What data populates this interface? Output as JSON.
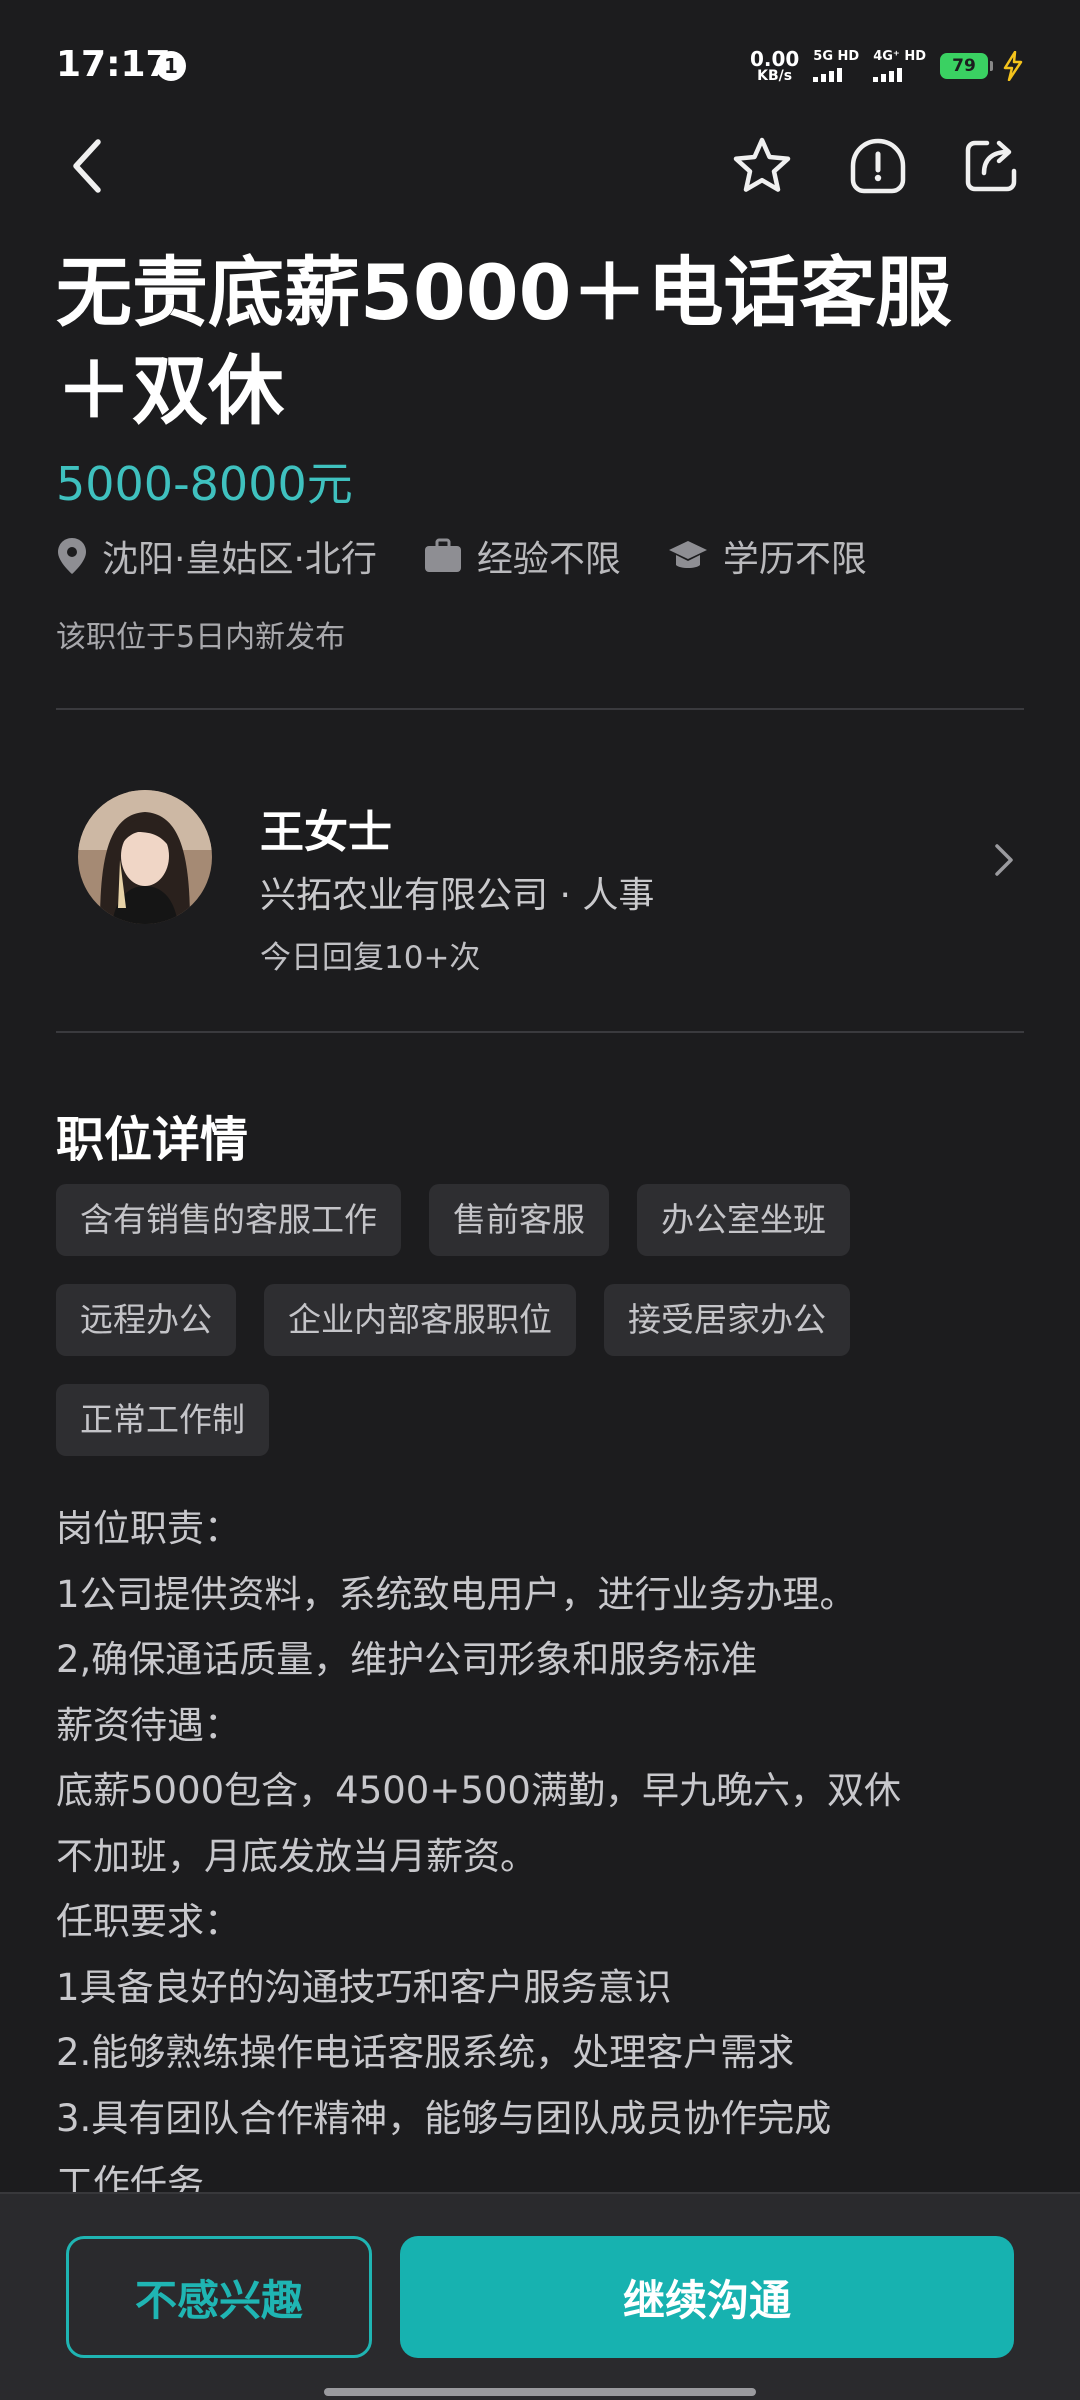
{
  "status_bar": {
    "time": "17:17",
    "alert_badge": "1",
    "net_speed_value": "0.00",
    "net_speed_unit": "KB/s",
    "sim1_label": "5G HD",
    "sim2_label": "4G⁺ HD",
    "battery": "79"
  },
  "icons": {
    "back": "chevron-left-icon",
    "favorite": "star-icon",
    "report": "alert-icon",
    "share": "share-icon",
    "location": "location-pin-icon",
    "experience": "briefcase-icon",
    "education": "graduation-cap-icon"
  },
  "job": {
    "title": "无责底薪5000＋电话客服＋双休",
    "salary": "5000-8000元",
    "location": "沈阳·皇姑区·北行",
    "experience": "经验不限",
    "education": "学历不限",
    "posted": "该职位于5日内新发布"
  },
  "recruiter": {
    "name": "王女士",
    "company": "兴拓农业有限公司 · 人事",
    "reply_stat": "今日回复10+次"
  },
  "details": {
    "section_title": "职位详情",
    "tags_row1": [
      "含有销售的客服工作",
      "售前客服",
      "办公室坐班"
    ],
    "tags_row2": [
      "远程办公",
      "企业内部客服职位",
      "接受居家办公"
    ],
    "tags_row3": [
      "正常工作制"
    ],
    "description_lines": [
      "岗位职责：",
      "1公司提供资料，系统致电用户，进行业务办理。",
      "2,确保通话质量，维护公司形象和服务标准",
      "薪资待遇：",
      "底薪5000包含，4500+500满勤，早九晚六，双休",
      "不加班，月底发放当月薪资。",
      "任职要求：",
      "1具备良好的沟通技巧和客户服务意识",
      "2.能够熟练操作电话客服系统，处理客户需求",
      "3.具有团队合作精神，能够与团队成员协作完成",
      "工作任务"
    ]
  },
  "actions": {
    "not_interested": "不感兴趣",
    "continue_chat": "继续沟通"
  },
  "colors": {
    "background": "#1c1c1e",
    "accent": "#17b2b0",
    "salary": "#3fc1bf",
    "tag_bg": "#2e2e31",
    "battery": "#3ad162"
  }
}
